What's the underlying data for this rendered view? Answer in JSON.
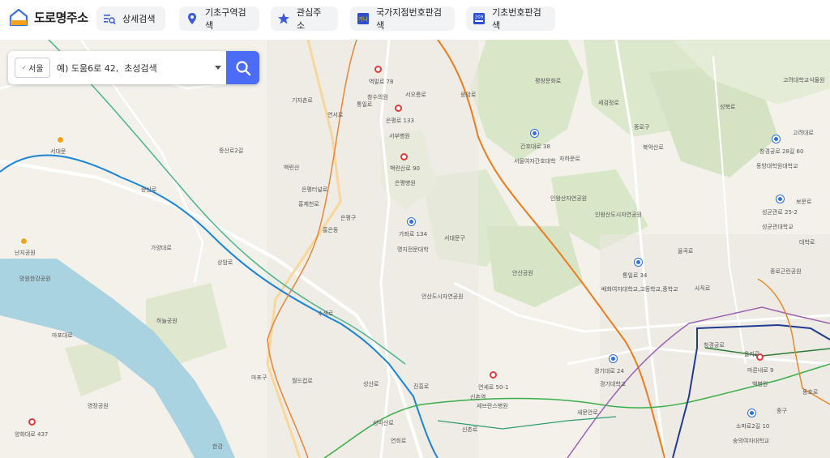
{
  "header": {
    "logo_text": "도로명주소",
    "nav": [
      {
        "label": "상세검색",
        "icon": "detail-search-icon"
      },
      {
        "label": "기초구역검색",
        "icon": "location-pin-icon"
      },
      {
        "label": "관심주소",
        "icon": "star-icon"
      },
      {
        "label": "국가지점번호판검색",
        "icon": "national-point-sign-icon",
        "icon_text": "가나"
      },
      {
        "label": "기초번호판검색",
        "icon": "basic-number-sign-icon",
        "icon_text": "209"
      }
    ]
  },
  "search": {
    "region": "서울",
    "placeholder": "예) 도움6로 42,  초성검색",
    "button_icon": "search-icon"
  },
  "map": {
    "pois": [
      {
        "label": "역말로 78",
        "pin": "red"
      },
      {
        "label": "창수의원",
        "pin": "none"
      },
      {
        "label": "은평로 133",
        "pin": "red"
      },
      {
        "label": "서부병원",
        "pin": "none"
      },
      {
        "label": "백련산로 90",
        "pin": "red"
      },
      {
        "label": "은평병원",
        "pin": "none"
      },
      {
        "label": "가좌로 134",
        "pin": "blue"
      },
      {
        "label": "명지전문대학",
        "pin": "none"
      },
      {
        "label": "서대문구",
        "pin": "none"
      },
      {
        "label": "안산도시자연공원",
        "pin": "none"
      },
      {
        "label": "안산공원",
        "pin": "none"
      },
      {
        "label": "종로구",
        "pin": "none"
      },
      {
        "label": "간호대로 38",
        "pin": "blue"
      },
      {
        "label": "서울여자간호대학",
        "pin": "none"
      },
      {
        "label": "인왕산자연공원",
        "pin": "none"
      },
      {
        "label": "인왕산도시자연공원",
        "pin": "none"
      },
      {
        "label": "통일로 34",
        "pin": "blue"
      },
      {
        "label": "배화여자대학교,고등학교,중학교",
        "pin": "none"
      },
      {
        "label": "창경궁로 28길 60",
        "pin": "blue"
      },
      {
        "label": "동방대학원대학교",
        "pin": "none"
      },
      {
        "label": "고려대학교식물원",
        "pin": "none"
      },
      {
        "label": "성균관로 25-2",
        "pin": "blue"
      },
      {
        "label": "성균관대학교",
        "pin": "none"
      },
      {
        "label": "종로근린공원",
        "pin": "none"
      },
      {
        "label": "경기대로 24",
        "pin": "blue"
      },
      {
        "label": "경기대학교",
        "pin": "none"
      },
      {
        "label": "연세로 50-1",
        "pin": "red"
      },
      {
        "label": "신촌역",
        "pin": "none"
      },
      {
        "label": "세브란스병원",
        "pin": "none"
      },
      {
        "label": "을지로",
        "pin": "none"
      },
      {
        "label": "마른내로 9",
        "pin": "red"
      },
      {
        "label": "백병원",
        "pin": "none"
      },
      {
        "label": "소파로2길 10",
        "pin": "blue"
      },
      {
        "label": "숭의여자대학교",
        "pin": "none"
      },
      {
        "label": "중구",
        "pin": "none"
      },
      {
        "label": "양화대로 437",
        "pin": "red"
      },
      {
        "label": "망원한강공원",
        "pin": "none"
      },
      {
        "label": "난지공원",
        "pin": "none"
      },
      {
        "label": "영장공원",
        "pin": "none"
      },
      {
        "label": "하늘공원",
        "pin": "none"
      },
      {
        "label": "상암로",
        "pin": "none"
      },
      {
        "label": "가양대로",
        "pin": "none"
      },
      {
        "label": "증산로",
        "pin": "none"
      },
      {
        "label": "수색로",
        "pin": "none"
      },
      {
        "label": "마포구",
        "pin": "none"
      },
      {
        "label": "성산로",
        "pin": "none"
      },
      {
        "label": "한강",
        "pin": "none"
      },
      {
        "label": "월드컵로",
        "pin": "none"
      },
      {
        "label": "홍은동",
        "pin": "none"
      },
      {
        "label": "서대문",
        "pin": "none"
      },
      {
        "label": "신촌로",
        "pin": "none"
      },
      {
        "label": "성미산로",
        "pin": "none"
      },
      {
        "label": "연희로",
        "pin": "none"
      },
      {
        "label": "진흥로",
        "pin": "none"
      },
      {
        "label": "백련산",
        "pin": "none"
      },
      {
        "label": "기자촌로",
        "pin": "none"
      },
      {
        "label": "평창문화로",
        "pin": "none"
      },
      {
        "label": "세검정로",
        "pin": "none"
      },
      {
        "label": "북악산로",
        "pin": "none"
      },
      {
        "label": "자하문로",
        "pin": "none"
      },
      {
        "label": "율곡로",
        "pin": "none"
      },
      {
        "label": "성북로",
        "pin": "none"
      },
      {
        "label": "창경궁로",
        "pin": "none"
      },
      {
        "label": "사직로",
        "pin": "none"
      },
      {
        "label": "새문안로",
        "pin": "none"
      },
      {
        "label": "고려대로",
        "pin": "none"
      },
      {
        "label": "보문로",
        "pin": "none"
      },
      {
        "label": "대학로",
        "pin": "none"
      },
      {
        "label": "동호로",
        "pin": "none"
      },
      {
        "label": "마포대로",
        "pin": "none"
      },
      {
        "label": "홍제천로",
        "pin": "none"
      },
      {
        "label": "통일로",
        "pin": "none"
      },
      {
        "label": "연서로",
        "pin": "none"
      },
      {
        "label": "은평터널로",
        "pin": "none"
      },
      {
        "label": "서오릉로",
        "pin": "none"
      },
      {
        "label": "응암로",
        "pin": "none"
      },
      {
        "label": "증산로2길",
        "pin": "none"
      },
      {
        "label": "은평구",
        "pin": "none"
      }
    ]
  }
}
